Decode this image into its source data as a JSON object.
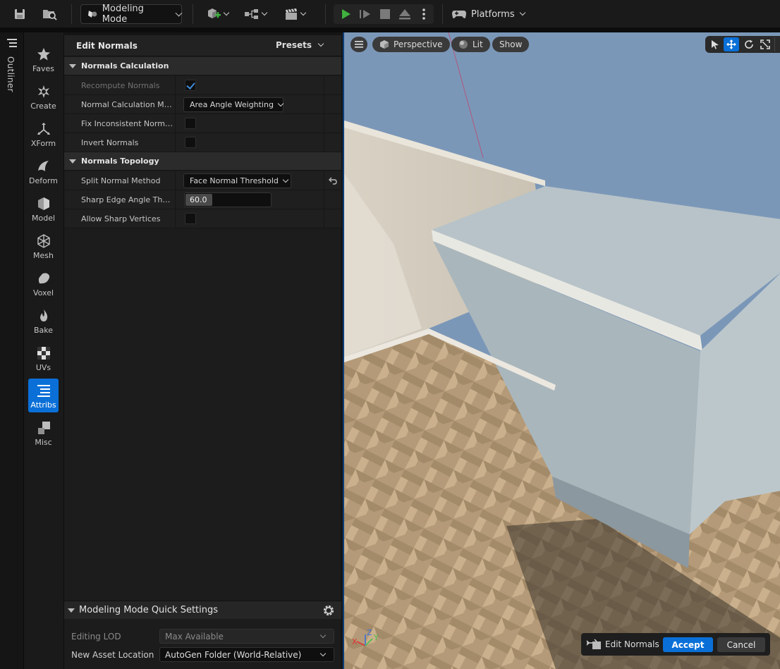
{
  "toolbar": {
    "mode_label": "Modeling Mode",
    "platforms_label": "Platforms"
  },
  "outliner": {
    "label": "Outliner"
  },
  "categories": [
    {
      "label": "Faves",
      "icon": "star-icon"
    },
    {
      "label": "Create",
      "icon": "create-icon"
    },
    {
      "label": "XForm",
      "icon": "xform-icon"
    },
    {
      "label": "Deform",
      "icon": "deform-icon"
    },
    {
      "label": "Model",
      "icon": "model-icon"
    },
    {
      "label": "Mesh",
      "icon": "mesh-icon"
    },
    {
      "label": "Voxel",
      "icon": "voxel-icon"
    },
    {
      "label": "Bake",
      "icon": "bake-icon"
    },
    {
      "label": "UVs",
      "icon": "uvs-icon"
    },
    {
      "label": "Attribs",
      "icon": "attribs-icon",
      "active": true
    },
    {
      "label": "Misc",
      "icon": "misc-icon"
    }
  ],
  "panel": {
    "title": "Edit Normals",
    "presets_label": "Presets",
    "sections": [
      {
        "title": "Normals Calculation"
      },
      {
        "title": "Normals Topology"
      }
    ],
    "rows": {
      "recompute": {
        "label": "Recompute Normals",
        "checked": true
      },
      "calc_method": {
        "label": "Normal Calculation Met...",
        "value": "Area Angle Weighting"
      },
      "fix_inconsistent": {
        "label": "Fix Inconsistent Normals",
        "checked": false
      },
      "invert": {
        "label": "Invert Normals",
        "checked": false
      },
      "split_method": {
        "label": "Split Normal Method",
        "value": "Face Normal Threshold"
      },
      "sharp_angle": {
        "label": "Sharp Edge Angle Thres...",
        "value": "60.0"
      },
      "allow_sharp": {
        "label": "Allow Sharp Vertices",
        "checked": false
      }
    },
    "quick": {
      "title": "Modeling Mode Quick Settings",
      "editing_lod_label": "Editing LOD",
      "editing_lod_value": "Max Available",
      "asset_location_label": "New Asset Location",
      "asset_location_value": "AutoGen Folder (World-Relative)"
    }
  },
  "viewport": {
    "perspective_label": "Perspective",
    "lit_label": "Lit",
    "show_label": "Show",
    "tool_label": "Edit Normals",
    "accept_label": "Accept",
    "cancel_label": "Cancel",
    "axes": {
      "x": "X",
      "y": "Y",
      "z": "Z"
    }
  },
  "colors": {
    "accent": "#0a70d8",
    "panel_bg": "#1c1c1c",
    "section_bg": "#2b2b2b",
    "play_green": "#3fb13f"
  }
}
